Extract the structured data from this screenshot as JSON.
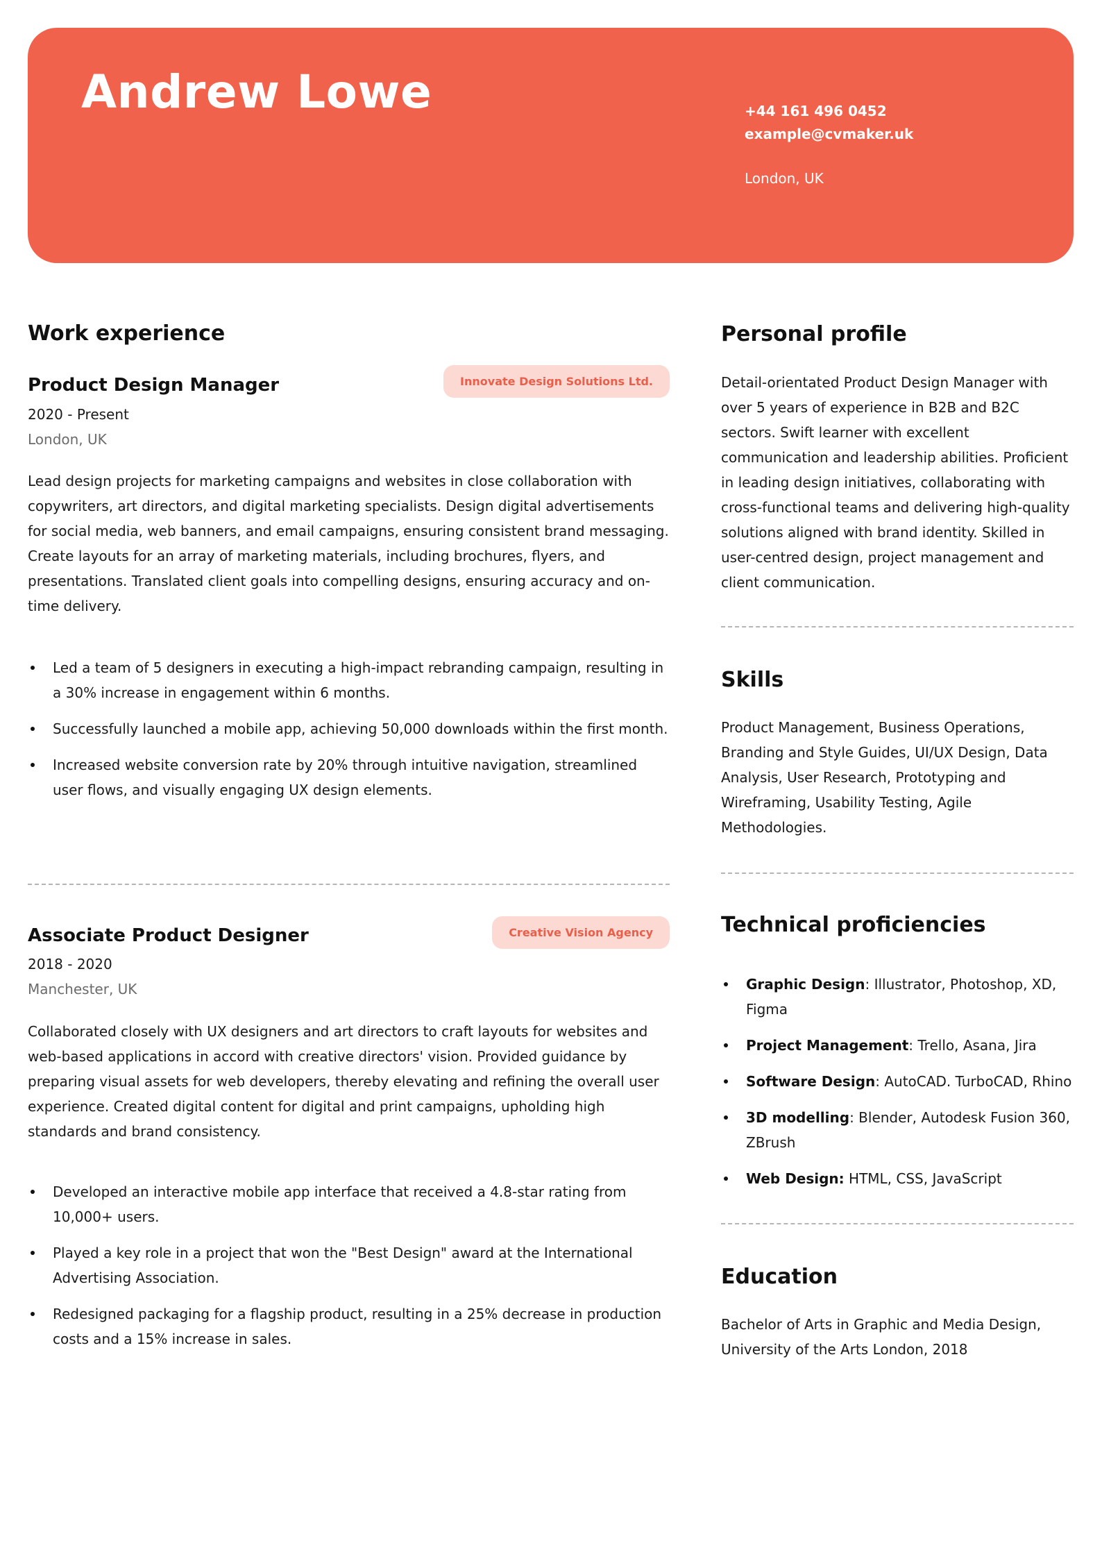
{
  "header": {
    "name": "Andrew Lowe",
    "phone": "+44 161 496 0452",
    "email": "example@cvmaker.uk",
    "location": "London, UK",
    "accent_color": "#f1624c"
  },
  "work_experience": {
    "heading": "Work experience",
    "jobs": [
      {
        "title": "Product Design Manager",
        "company": "Innovate Design Solutions Ltd.",
        "dates": "2020 - Present",
        "location": "London, UK",
        "description": "Lead design projects for marketing campaigns and websites in close collaboration with copywriters, art directors, and digital marketing specialists. Design digital advertisements for social media, web banners, and email campaigns, ensuring consistent brand messaging. Create layouts for an array of marketing materials, including brochures, flyers, and presentations. Translated client goals into compelling designs, ensuring accuracy and on-time delivery.",
        "achievements": [
          "Led a team of 5 designers in executing a high-impact rebranding campaign, resulting in a 30% increase in engagement within 6 months.",
          "Successfully launched a mobile app, achieving 50,000 downloads within the first month.",
          "Increased website conversion rate by 20% through intuitive navigation, streamlined user flows, and visually engaging UX design elements."
        ]
      },
      {
        "title": "Associate Product Designer",
        "company": "Creative Vision Agency",
        "dates": "2018 - 2020",
        "location": "Manchester, UK",
        "description": "Collaborated closely with UX designers and art directors to craft layouts for websites and web-based applications in accord with creative directors' vision. Provided guidance by preparing visual assets for web developers, thereby elevating and refining the overall user experience. Created digital content for digital and print campaigns, upholding high standards and brand consistency.",
        "achievements": [
          "Developed an interactive mobile app interface that received a 4.8-star rating from 10,000+ users.",
          "Played a key role in a project that won the \"Best Design\" award at the International Advertising Association.",
          "Redesigned packaging for a flagship product, resulting in a 25% decrease in production costs and a 15% increase in sales."
        ]
      }
    ]
  },
  "personal_profile": {
    "heading": "Personal profile",
    "text": "Detail-orientated Product Design Manager with over 5 years of experience in B2B and B2C sectors. Swift learner with excellent communication and leadership abilities. Proficient in leading design initiatives, collaborating with cross-functional teams and delivering high-quality solutions aligned with brand identity. Skilled in user-centred design, project management and client communication."
  },
  "skills": {
    "heading": "Skills",
    "text": "Product Management, Business Operations, Branding and Style Guides, UI/UX Design, Data Analysis, User Research, Prototyping and Wireframing, Usability Testing, Agile Methodologies."
  },
  "technical": {
    "heading": "Technical proficiencies",
    "items": [
      {
        "label": "Graphic Design",
        "sep": ": ",
        "value": "Illustrator, Photoshop, XD, Figma"
      },
      {
        "label": "Project Management",
        "sep": ": ",
        "value": "Trello, Asana, Jira"
      },
      {
        "label": "Software Design",
        "sep": ": ",
        "value": "AutoCAD. TurboCAD, Rhino"
      },
      {
        "label": "3D modelling",
        "sep": ": ",
        "value": "Blender, Autodesk Fusion 360, ZBrush"
      },
      {
        "label": "Web Design:",
        "sep": " ",
        "value": "HTML, CSS, JavaScript"
      }
    ]
  },
  "education": {
    "heading": "Education",
    "text": "Bachelor of Arts in Graphic and Media Design, University of the Arts London, 2018"
  }
}
